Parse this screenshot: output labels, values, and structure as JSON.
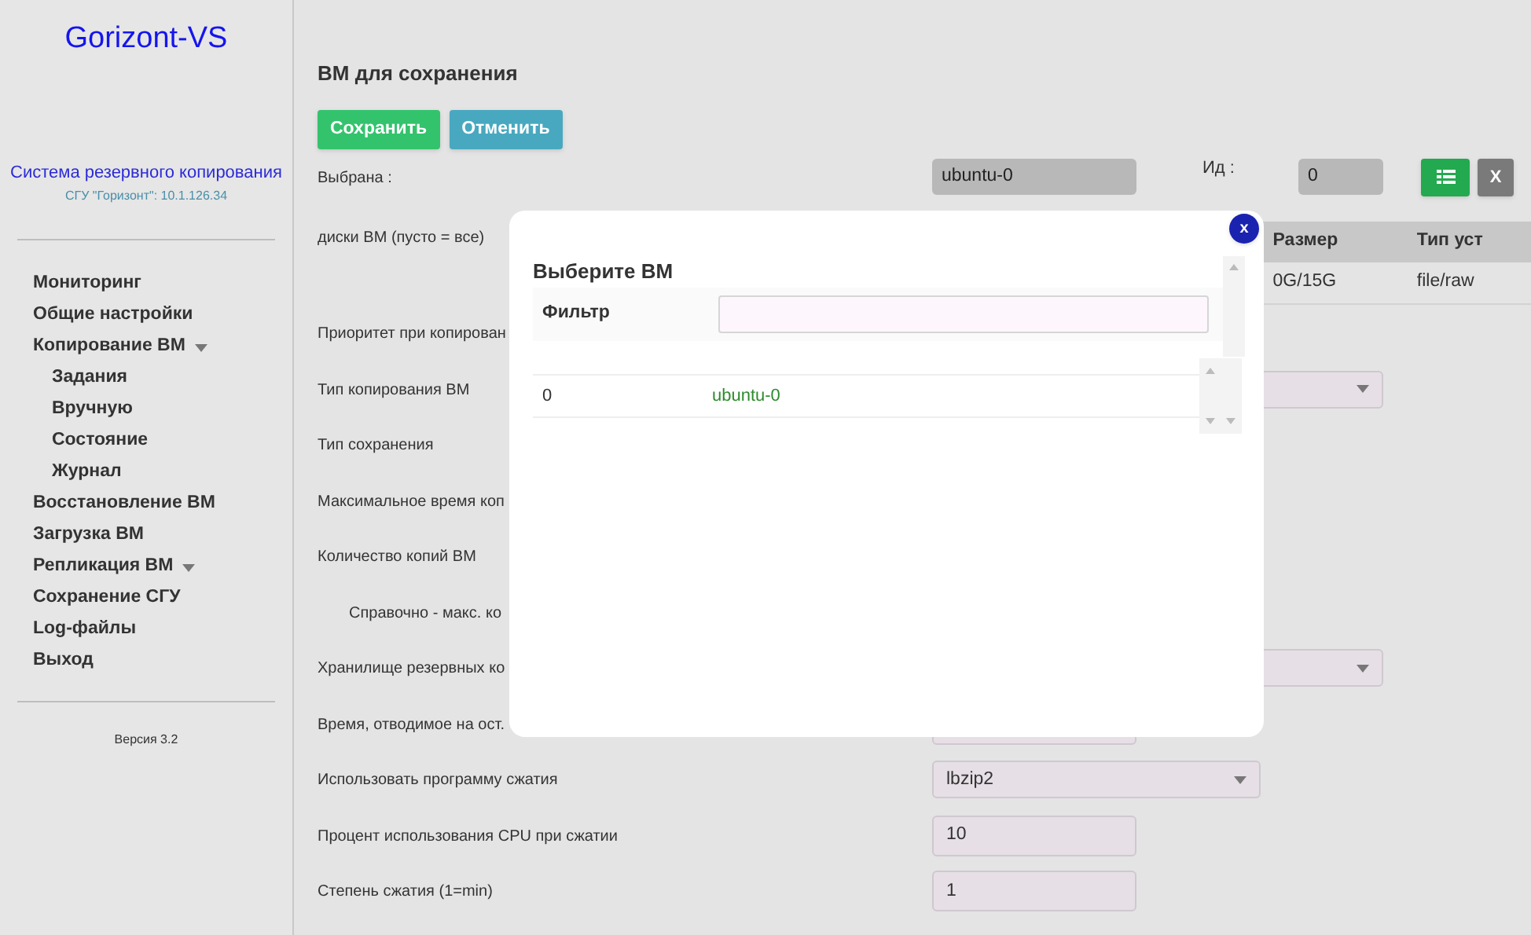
{
  "sidebar": {
    "logo": "Gorizont-VS",
    "subtitle": "Система резервного копирования",
    "host": "СГУ \"Горизонт\": 10.1.126.34",
    "menu": [
      {
        "label": "Мониторинг",
        "has_submenu": false
      },
      {
        "label": "Общие настройки",
        "has_submenu": false
      },
      {
        "label": "Копирование ВМ",
        "has_submenu": true,
        "children": [
          {
            "label": "Задания"
          },
          {
            "label": "Вручную"
          },
          {
            "label": "Состояние"
          },
          {
            "label": "Журнал"
          }
        ]
      },
      {
        "label": "Восстановление ВМ",
        "has_submenu": false
      },
      {
        "label": "Загрузка ВМ",
        "has_submenu": false
      },
      {
        "label": "Репликация ВМ",
        "has_submenu": true
      },
      {
        "label": "Сохранение СГУ",
        "has_submenu": false
      },
      {
        "label": "Log-файлы",
        "has_submenu": false
      },
      {
        "label": "Выход",
        "has_submenu": false
      }
    ],
    "version": "Версия 3.2"
  },
  "main": {
    "title": "ВМ для сохранения",
    "buttons": [
      {
        "label": "Сохранить",
        "kind": "save"
      },
      {
        "label": "Отменить",
        "kind": "cancel"
      }
    ],
    "rows": [
      {
        "kind": "selected",
        "label": "Выбрана :",
        "value": "ubuntu-0",
        "id_label": "Ид :",
        "id_value": "0",
        "clear_button": "X"
      },
      {
        "kind": "disks",
        "label": "диски ВМ (пусто = все)",
        "table": {
          "columns": [
            "Размер",
            "Тип уст"
          ],
          "rows": [
            [
              "0G/15G",
              "file/raw"
            ]
          ]
        }
      },
      {
        "kind": "plain",
        "label": "Приоритет при копирован"
      },
      {
        "kind": "wide-select",
        "label": "Тип копирования ВМ"
      },
      {
        "kind": "plain",
        "label": "Тип сохранения"
      },
      {
        "kind": "plain",
        "label": "Максимальное время коп"
      },
      {
        "kind": "plain",
        "label": "Количество копий ВМ"
      },
      {
        "kind": "note",
        "label": "Справочно - макс. ко"
      },
      {
        "kind": "wide-select",
        "label": "Хранилище резервных ко"
      },
      {
        "kind": "field",
        "label": "Время, отводимое на ост."
      },
      {
        "kind": "select",
        "label": "Использовать программу сжатия",
        "value": "lbzip2"
      },
      {
        "kind": "field",
        "label": "Процент использования CPU при сжатии",
        "value": "10"
      },
      {
        "kind": "field",
        "label": "Степень сжатия (1=min)",
        "value": "1"
      }
    ]
  },
  "dialog": {
    "title": "Выберите ВМ",
    "filter_label": "Фильтр",
    "close": "x",
    "rows": [
      {
        "id": "0",
        "name": "ubuntu-0"
      }
    ]
  }
}
